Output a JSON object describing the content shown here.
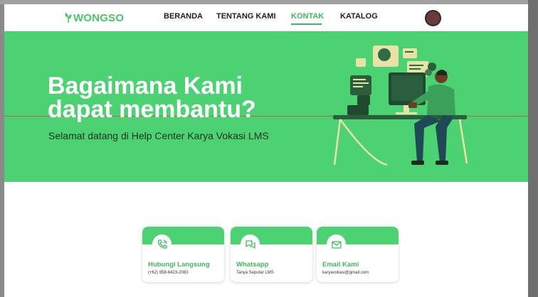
{
  "brand": {
    "name": "WONGSO",
    "color": "#49c566"
  },
  "nav": {
    "items": [
      {
        "label": "BERANDA",
        "active": false
      },
      {
        "label": "TENTANG KAMI",
        "active": false
      },
      {
        "label": "KONTAK",
        "active": true
      },
      {
        "label": "KATALOG",
        "active": false
      }
    ]
  },
  "hero": {
    "title": "Bagaimana Kami\ndapat membantu?",
    "subtitle": "Selamat datang di Help Center Karya Vokasi LMS",
    "background": "#4dd273"
  },
  "contacts": [
    {
      "icon": "phone-icon",
      "title": "Hubungi Langsung",
      "desc": "(+62) 858-6423-2083"
    },
    {
      "icon": "chat-icon",
      "title": "Whatsapp",
      "desc": "Tanya Seputar LMS"
    },
    {
      "icon": "mail-icon",
      "title": "Email Kami",
      "desc": "karyavokasi@gmail.com"
    }
  ],
  "colors": {
    "accent": "#3dbb5c",
    "text": "#1e1e1e"
  }
}
